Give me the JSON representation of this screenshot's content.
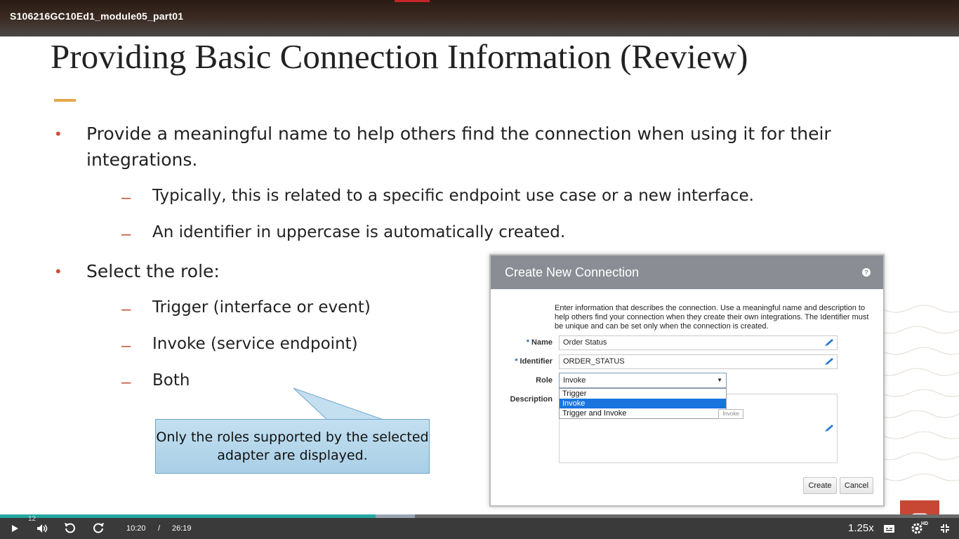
{
  "video": {
    "title": "S106216GC10Ed1_module05_part01"
  },
  "slide": {
    "title": "Providing Basic Connection Information (Review)",
    "bullets": [
      {
        "text": "Provide a meaningful name to help others find the connection when using it for their integrations.",
        "subs": [
          "Typically, this is related to a specific endpoint use case or a new interface.",
          "An identifier in uppercase is automatically created."
        ]
      },
      {
        "text": "Select the role:",
        "subs": [
          "Trigger (interface or event)",
          "Invoke (service endpoint)",
          "Both"
        ]
      }
    ],
    "callout": "Only the roles supported by the selected adapter are displayed.",
    "number": "12"
  },
  "dialog": {
    "title": "Create New Connection",
    "help": "?",
    "description": "Enter information that describes the connection. Use a meaningful name and description to help others find your connection when they create their own integrations. The Identifier must be unique and can be set only when the connection is created.",
    "name_label": "Name",
    "name_value": "Order Status",
    "identifier_label": "Identifier",
    "identifier_value": "ORDER_STATUS",
    "role_label": "Role",
    "role_value": "Invoke",
    "role_options": [
      "Trigger",
      "Invoke",
      "Trigger and Invoke"
    ],
    "tooltip": "Invoke",
    "description_label": "Description",
    "required_mark": "*",
    "create_label": "Create",
    "cancel_label": "Cancel"
  },
  "player": {
    "current_time": "10:20",
    "separator": "/",
    "duration": "26:19",
    "speed": "1.25x",
    "hd_badge": "HD",
    "progress_fraction": 0.392,
    "buffered_fraction": 0.433,
    "icons": [
      "play-icon",
      "volume-icon",
      "rewind-icon",
      "forward-icon",
      "captions-icon",
      "settings-icon",
      "fullscreen-exit-icon"
    ]
  },
  "colors": {
    "bullet_accent": "#c8523a",
    "title_rule": "#e5a84b",
    "dialog_header": "#8a8e94",
    "selected_option": "#1a74e0",
    "progress": "#22a7a0",
    "logo": "#c74634"
  }
}
